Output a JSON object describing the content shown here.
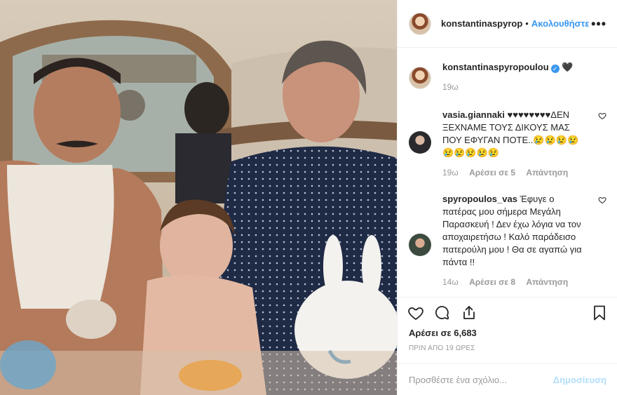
{
  "header": {
    "username": "konstantinaspyrop",
    "separator": "•",
    "follow_label": "Ακολουθήστε",
    "more_icon": "more-horizontal-icon",
    "more_label": "•••"
  },
  "caption": {
    "username": "konstantinaspyropoulou",
    "verified_icon": "verified-badge-icon",
    "verified_glyph": "✓",
    "text": "🖤",
    "time": "19ω"
  },
  "comments": [
    {
      "username": "vasia.giannaki",
      "text": "♥♥♥♥♥♥♥♥ΔΕΝ ΞΕΧΝΑΜΕ ΤΟΥΣ ΔΙΚΟΥΣ ΜΑΣ ΠΟΥ ΕΦΥΓΑΝ ΠΟΤΕ..😢😢😢😢😢😢😢😢😢",
      "time": "19ω",
      "likes": "Αρέσει σε 5",
      "reply": "Απάντηση"
    },
    {
      "username": "spyropoulos_vas",
      "text": "Έφυγε ο πατέρας μου σήμερα Μεγάλη Παρασκευή ! Δεν έχω λόγια να τον αποχαιρετήσω ! Καλό παράδεισο πατερούλη μου ! Θα σε αγαπώ για πάντα !!",
      "time": "14ω",
      "likes": "Αρέσει σε 8",
      "reply": "Απάντηση"
    }
  ],
  "actions": {
    "icons": [
      "heart-icon",
      "comment-icon",
      "share-icon",
      "bookmark-icon"
    ],
    "likes_text": "Αρέσει σε 6,683",
    "timestamp": "ΠΡΙΝ ΑΠΟ 19 ΩΡΕΣ"
  },
  "add_comment": {
    "placeholder": "Προσθέστε ένα σχόλιο...",
    "post_label": "Δημοσίευση"
  },
  "colors": {
    "link": "#3897f0",
    "text": "#262626",
    "muted": "#999999",
    "border": "#efefef",
    "post_disabled": "#b2dffc"
  }
}
